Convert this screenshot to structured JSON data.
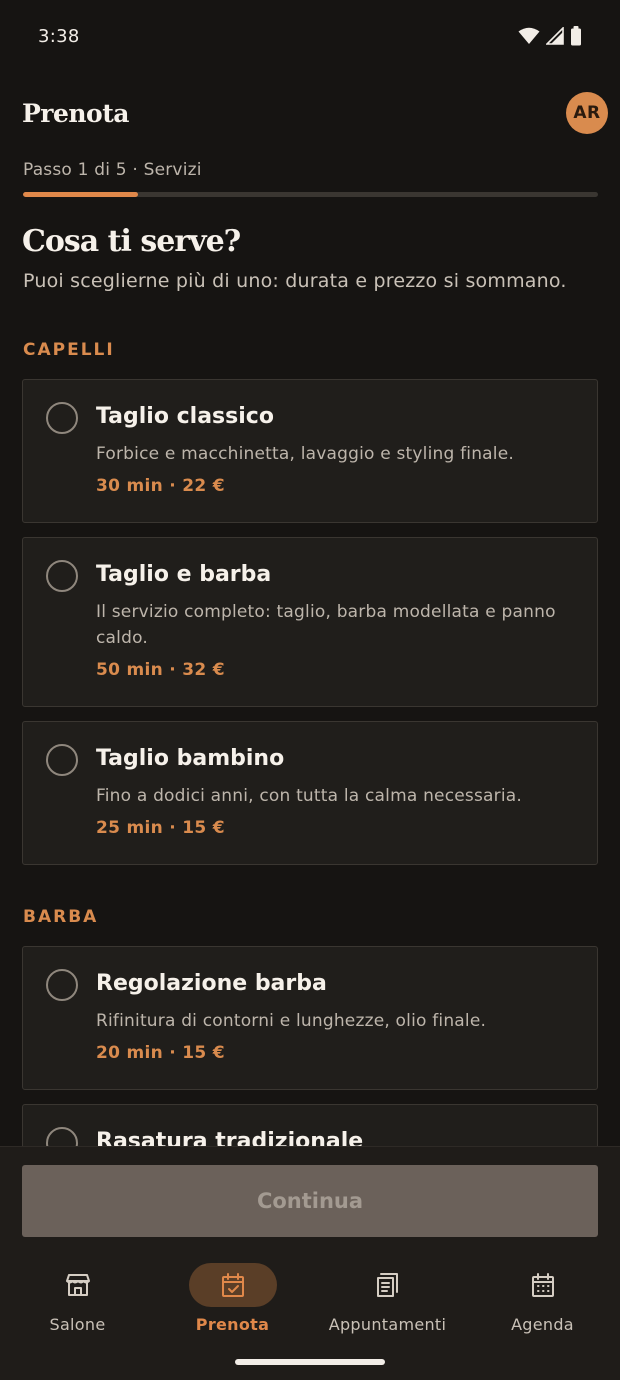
{
  "status_bar": {
    "time": "3:38"
  },
  "header": {
    "title": "Prenota",
    "avatar_initials": "AR"
  },
  "progress": {
    "label": "Passo 1 di 5 · Servizi",
    "fraction": 0.2
  },
  "main": {
    "title": "Cosa ti serve?",
    "subtitle": "Puoi sceglierne più di uno: durata e prezzo si sommano.",
    "sections": [
      {
        "label": "CAPELLI",
        "services": [
          {
            "name": "Taglio classico",
            "description": "Forbice e macchinetta, lavaggio e styling finale.",
            "meta": "30 min · 22 €"
          },
          {
            "name": "Taglio e barba",
            "description": "Il servizio completo: taglio, barba modellata e panno caldo.",
            "meta": "50 min · 32 €"
          },
          {
            "name": "Taglio bambino",
            "description": "Fino a dodici anni, con tutta la calma necessaria.",
            "meta": "25 min · 15 €"
          }
        ]
      },
      {
        "label": "BARBA",
        "services": [
          {
            "name": "Regolazione barba",
            "description": "Rifinitura di contorni e lunghezze, olio finale.",
            "meta": "20 min · 15 €"
          },
          {
            "name": "Rasatura tradizionale",
            "description": "",
            "meta": ""
          }
        ]
      }
    ]
  },
  "actions": {
    "continue_label": "Continua"
  },
  "nav": {
    "items": [
      {
        "label": "Salone",
        "icon": "storefront-icon",
        "active": false
      },
      {
        "label": "Prenota",
        "icon": "calendar-check-icon",
        "active": true
      },
      {
        "label": "Appuntamenti",
        "icon": "receipt-icon",
        "active": false
      },
      {
        "label": "Agenda",
        "icon": "calendar-grid-icon",
        "active": false
      }
    ]
  },
  "colors": {
    "background": "#161412",
    "accent": "#d98b4e",
    "card": "#201e1b",
    "button_disabled": "#6b615a"
  }
}
